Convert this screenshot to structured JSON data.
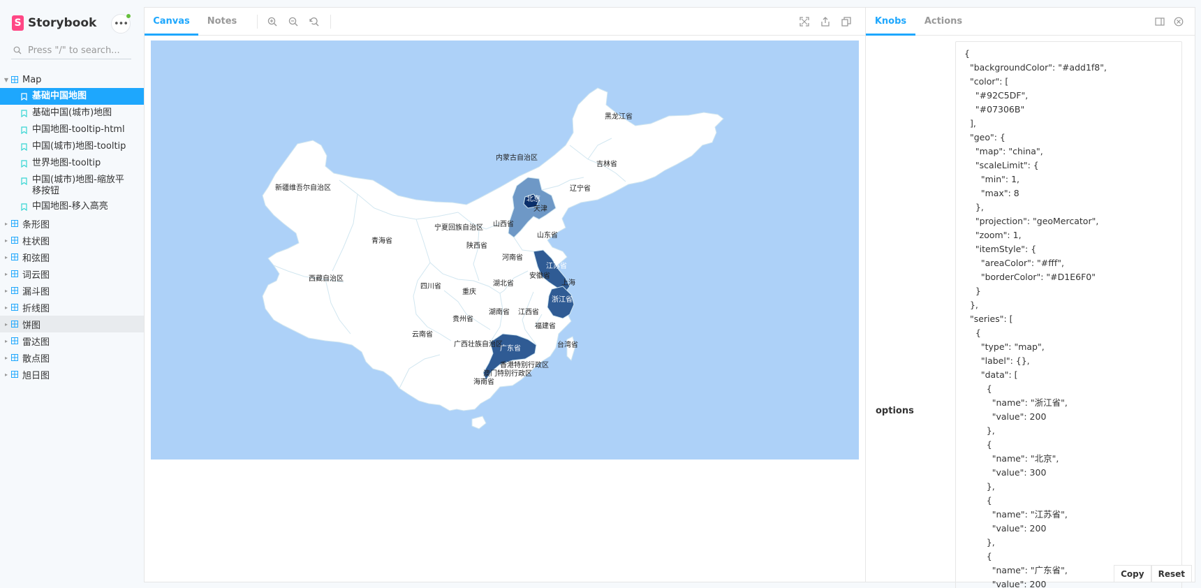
{
  "sidebar": {
    "brand": "Storybook",
    "brand_letter": "S",
    "menu_glyph": "•••",
    "search_placeholder": "Press \"/\" to search...",
    "map_group": "Map",
    "map_stories": [
      "基础中国地图",
      "基础中国(城市)地图",
      "中国地图-tooltip-html",
      "中国(城市)地图-tooltip",
      "世界地图-tooltip",
      "中国(城市)地图-缩放平\n移按钮",
      "中国地图-移入高亮"
    ],
    "groups": [
      "条形图",
      "柱状图",
      "和弦图",
      "词云图",
      "漏斗图",
      "折线图",
      "饼图",
      "雷达图",
      "散点图",
      "旭日图"
    ]
  },
  "canvas": {
    "tabs": [
      "Canvas",
      "Notes"
    ],
    "toolbar_icons": [
      "zoom-in-icon",
      "zoom-out-icon",
      "zoom-reset-icon",
      "fullscreen-icon",
      "share-icon",
      "copy-icon"
    ],
    "map": {
      "background": "#add1f8",
      "labels": {
        "heilongjiang": "黑龙江省",
        "neimenggu": "内蒙古自治区",
        "jilin": "吉林省",
        "xinjiang": "新疆维吾尔自治区",
        "liaoning": "辽宁省",
        "beijing": "北京",
        "tianjin": "天津",
        "ningxia": "宁夏回族自治区",
        "shanxi": "山西省",
        "shandong": "山东省",
        "qinghai": "青海省",
        "shaanxi": "陕西省",
        "henan": "河南省",
        "jiangsu": "江苏省",
        "anhui": "安徽省",
        "shanghai": "上海",
        "xizang": "西藏自治区",
        "sichuan": "四川省",
        "hubei": "湖北省",
        "chongqing": "重庆",
        "zhejiang": "浙江省",
        "hunan": "湖南省",
        "jiangxi": "江西省",
        "guizhou": "贵州省",
        "fujian": "福建省",
        "yunnan": "云南省",
        "guangxi": "广西壮族自治区",
        "guangdong": "广东省",
        "taiwan": "台湾省",
        "hongkong": "香港特别行政区",
        "macau": "澳门特别行政区",
        "hainan": "海南省"
      }
    }
  },
  "addons": {
    "tabs": [
      "Knobs",
      "Actions"
    ],
    "options_label": "options",
    "json_lines": [
      "{",
      "  \"backgroundColor\": \"#add1f8\",",
      "  \"color\": [",
      "    \"#92C5DF\",",
      "    \"#07306B\"",
      "  ],",
      "  \"geo\": {",
      "    \"map\": \"china\",",
      "    \"scaleLimit\": {",
      "      \"min\": 1,",
      "      \"max\": 8",
      "    },",
      "    \"projection\": \"geoMercator\",",
      "    \"zoom\": 1,",
      "    \"itemStyle\": {",
      "      \"areaColor\": \"#fff\",",
      "      \"borderColor\": \"#D1E6F0\"",
      "    }",
      "  },",
      "  \"series\": [",
      "    {",
      "      \"type\": \"map\",",
      "      \"label\": {},",
      "      \"data\": [",
      "        {",
      "          \"name\": \"浙江省\",",
      "          \"value\": 200",
      "        },",
      "        {",
      "          \"name\": \"北京\",",
      "          \"value\": 300",
      "        },",
      "        {",
      "          \"name\": \"江苏省\",",
      "          \"value\": 200",
      "        },",
      "        {",
      "          \"name\": \"广东省\",",
      "          \"value\": 200"
    ],
    "copy_label": "Copy",
    "reset_label": "Reset"
  },
  "colors": {
    "accent": "#1ea7fd",
    "brand": "#ff4785",
    "map_low": "#92C5DF",
    "map_high": "#07306B"
  }
}
